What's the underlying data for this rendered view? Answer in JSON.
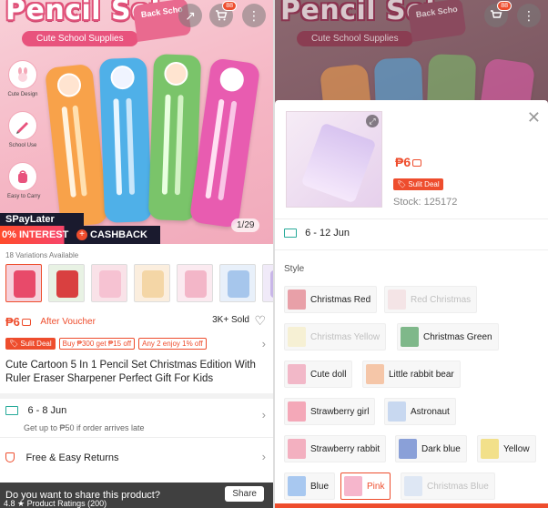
{
  "left": {
    "hero": {
      "title": "Pencil Set",
      "badge": "Cute School Supplies",
      "corner_badge": "Back Scho",
      "features": [
        "Cute Design",
        "School Use",
        "Easy to Carry"
      ],
      "cart_count": "88",
      "image_counter": "1/29",
      "spaylater": "SPayLater",
      "interest": "0% INTEREST",
      "cashback": "CASHBACK"
    },
    "variations_available": "18 Variations Available",
    "price": "₱6",
    "after_voucher": "After Voucher",
    "sold": "3K+ Sold",
    "tags": [
      "Sulit Deal",
      "Buy ₱300 get ₱15 off",
      "Any 2 enjoy 1% off"
    ],
    "title": "Cute Cartoon 5 In 1 Pencil Set Christmas Edition With Ruler Eraser Sharpener Perfect Gift For Kids",
    "shipping": {
      "dates": "6 - 8 Jun",
      "sub": "Get up to ₱50 if order arrives late"
    },
    "returns": "Free & Easy Returns",
    "share_prompt": "Do you want to share this product?",
    "share_button": "Share",
    "ratings_peek": "4.8 ★ Product Ratings (200)"
  },
  "right": {
    "hero": {
      "title": "Pencil Set",
      "badge": "Cute School Supplies",
      "corner_badge": "Back Scho",
      "cart_count": "88"
    },
    "price": "₱6",
    "tag": "Sulit Deal",
    "stock": "Stock: 125172",
    "shipping_dates": "6 - 12 Jun",
    "style_label": "Style",
    "options": [
      {
        "label": "Christmas Red",
        "state": "normal",
        "color": "#e8a0a8"
      },
      {
        "label": "Red Christmas",
        "state": "disabled",
        "color": "#f0c8cc"
      },
      {
        "label": "Christmas Yellow",
        "state": "disabled",
        "color": "#f5e6a0"
      },
      {
        "label": "Christmas Green",
        "state": "normal",
        "color": "#7fb88a"
      },
      {
        "label": "Cute doll",
        "state": "normal",
        "color": "#f2b8c8"
      },
      {
        "label": "Little rabbit bear",
        "state": "normal",
        "color": "#f5c6a8"
      },
      {
        "label": "Strawberry girl",
        "state": "normal",
        "color": "#f4a8b8"
      },
      {
        "label": "Astronaut",
        "state": "normal",
        "color": "#c8d8f0"
      },
      {
        "label": "Strawberry rabbit",
        "state": "normal",
        "color": "#f3b0c0"
      },
      {
        "label": "Dark blue",
        "state": "normal",
        "color": "#8aa0d8"
      },
      {
        "label": "Yellow",
        "state": "normal",
        "color": "#f2e08a"
      },
      {
        "label": "Blue",
        "state": "normal",
        "color": "#a8c8f0"
      },
      {
        "label": "Pink",
        "state": "selected",
        "color": "#f6b6cc"
      },
      {
        "label": "Christmas Blue",
        "state": "disabled",
        "color": "#b8d0f0"
      }
    ]
  },
  "colors": {
    "accent": "#ee4d2d",
    "teal": "#26aa99"
  }
}
